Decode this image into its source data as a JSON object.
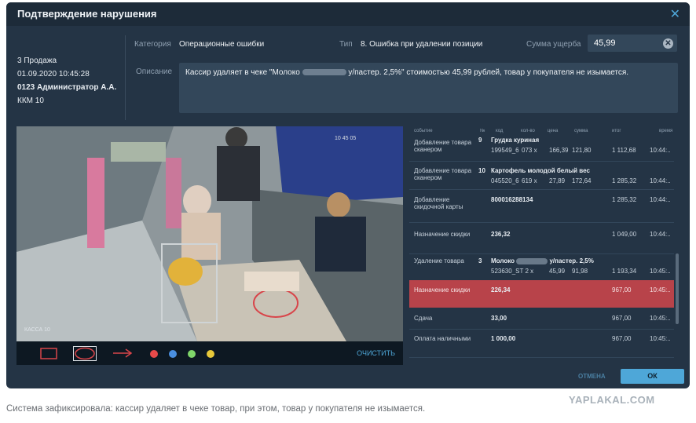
{
  "dialog": {
    "title": "Подтверждение нарушения",
    "close_icon": "close-icon"
  },
  "info": {
    "store": "3 Продажа",
    "datetime": "01.09.2020 10:45:28",
    "cashier": "0123 Администратор А.А.",
    "register": "ККМ 10"
  },
  "fields": {
    "category_label": "Категория",
    "category_value": "Операционные ошибки",
    "type_label": "Тип",
    "type_value": "8. Ошибка при удалении позиции",
    "amount_label": "Сумма ущерба",
    "amount_value": "45,99",
    "description_label": "Описание",
    "description_pre": "Кассир удаляет в чеке \"Молоко",
    "description_post": "у/пастер. 2,5%\" стоимостью 45,99 рублей,  товар у покупателя не изымается."
  },
  "video": {
    "timestamp": "10 45 05",
    "camera_label": "КАССА 10",
    "toolbar": {
      "tools": [
        "rectangle-tool-icon",
        "ellipse-tool-icon",
        "arrow-tool-icon"
      ],
      "colors": [
        "#e84a4a",
        "#4a8fe0",
        "#7fd66a",
        "#e8c93a"
      ],
      "clear_label": "ОЧИСТИТЬ"
    }
  },
  "table": {
    "headers": [
      "событие",
      "№",
      "код",
      "кол-во",
      "цена",
      "сумма",
      "итог",
      "время"
    ],
    "rows": [
      {
        "event": "Добавление товара сканером",
        "num": "9",
        "name": "Грудка куриная",
        "code": "199549_6",
        "qty": "073 x",
        "price": "166,39",
        "sum": "121,80",
        "total": "1 112,68",
        "time": "10:44:..",
        "selected": false
      },
      {
        "event": "Добавление товара сканером",
        "num": "10",
        "name": "Картофель молодой белый вес",
        "code": "045520_6",
        "qty": "619 x",
        "price": "27,89",
        "sum": "172,64",
        "total": "1 285,32",
        "time": "10:44:..",
        "selected": false
      },
      {
        "event": "Добавление скидочной карты",
        "num": "",
        "name": "800016288134",
        "code": "",
        "qty": "",
        "price": "",
        "sum": "",
        "total": "1 285,32",
        "time": "10:44:..",
        "selected": false
      },
      {
        "event": "Назначение скидки",
        "num": "",
        "name": "236,32",
        "code": "",
        "qty": "",
        "price": "",
        "sum": "",
        "total": "1 049,00",
        "time": "10:44:..",
        "selected": false
      },
      {
        "event": "Удаление товара",
        "num": "3",
        "name": "Молоко",
        "name_post": "у/пастер. 2,5%",
        "code": "523630_ST 2 x",
        "qty": "",
        "price": "45,99",
        "sum": "91,98",
        "total": "1 193,34",
        "time": "10:45:..",
        "selected": false
      },
      {
        "event": "Назначение скидки",
        "num": "",
        "name": "226,34",
        "code": "",
        "qty": "",
        "price": "",
        "sum": "",
        "total": "967,00",
        "time": "10:45:..",
        "selected": true
      },
      {
        "event": "Сдача",
        "num": "",
        "name": "33,00",
        "code": "",
        "qty": "",
        "price": "",
        "sum": "",
        "total": "967,00",
        "time": "10:45:..",
        "selected": false
      },
      {
        "event": "Оплата наличными",
        "num": "",
        "name": "1 000,00",
        "code": "",
        "qty": "",
        "price": "",
        "sum": "",
        "total": "967,00",
        "time": "10:45:..",
        "selected": false
      }
    ]
  },
  "footer": {
    "cancel_label": "ОТМЕНА",
    "ok_label": "ОК"
  },
  "watermark": "YAPLAKAL.COM",
  "caption": "Система зафиксировала: кассир удаляет в чеке товар, при этом, товар у покупателя не изымается.",
  "colors": {
    "accent": "#4ea7d8",
    "selected_row": "#b8434a",
    "dialog_bg": "#243445"
  }
}
